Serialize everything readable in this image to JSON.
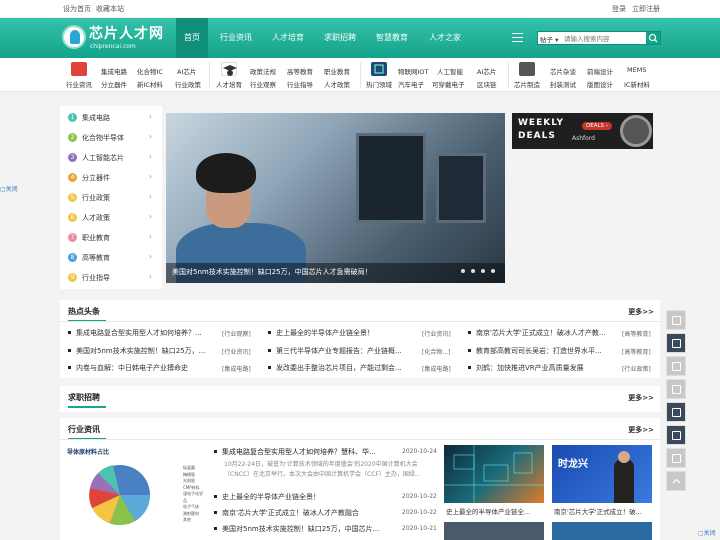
{
  "topbar": {
    "home": "设为首页",
    "favorite": "收藏本站",
    "login": "登录",
    "register": "立即注册"
  },
  "logo": {
    "name": "芯片人才网",
    "domain": "chiprencai.com"
  },
  "nav": [
    {
      "label": "首页",
      "active": true
    },
    {
      "label": "行业资讯"
    },
    {
      "label": "人才培育"
    },
    {
      "label": "求职招聘"
    },
    {
      "label": "智慧教育"
    },
    {
      "label": "人才之家"
    }
  ],
  "search": {
    "select": "帖子",
    "placeholder": "请输入搜索内容"
  },
  "categories": [
    {
      "label": "行业资讯",
      "icon": "news-icon",
      "color": "#e0433a",
      "links": [
        "集成电路",
        "化合物IC",
        "AI芯片",
        "分立器件",
        "新IC材料",
        "行业政策"
      ]
    },
    {
      "label": "人才培育",
      "icon": "graduate-icon",
      "color": "#333333",
      "links": [
        "政策法规",
        "高等教育",
        "职业教育",
        "行业观察",
        "行业指导",
        "人才政策"
      ]
    },
    {
      "label": "热门领域",
      "icon": "chip-icon",
      "color": "#1a4a7a",
      "links": [
        "物联网IOT",
        "人工智能",
        "AI芯片",
        "汽车电子",
        "可穿戴电子",
        "区块链"
      ]
    },
    {
      "label": "芯片制造",
      "icon": "wafer-icon",
      "color": "#555555",
      "links": [
        "芯片杂谈",
        "前端设计",
        "MEMS",
        "封装测试",
        "版图设计",
        "IC新材料"
      ]
    }
  ],
  "sidebar": [
    {
      "num": "1",
      "label": "集成电路",
      "color": "#4cc3b0"
    },
    {
      "num": "2",
      "label": "化合物半导体",
      "color": "#8bc34a"
    },
    {
      "num": "3",
      "label": "人工智能芯片",
      "color": "#8e6fb8"
    },
    {
      "num": "4",
      "label": "分立器件",
      "color": "#f0a23a"
    },
    {
      "num": "5",
      "label": "行业政策",
      "color": "#f4c542"
    },
    {
      "num": "6",
      "label": "人才政策",
      "color": "#f4c542"
    },
    {
      "num": "7",
      "label": "职业教育",
      "color": "#e88ca0"
    },
    {
      "num": "8",
      "label": "高等教育",
      "color": "#4a9ee0"
    },
    {
      "num": "9",
      "label": "行业指导",
      "color": "#f4c542"
    }
  ],
  "banner": {
    "caption": "美国对5nm技术实施控制！缺口25万，中国芯片人才急需破局！"
  },
  "ad": {
    "line1": "WEEKLY",
    "line2": "DEALS",
    "badge": "DEALS ›",
    "brand": "Ashford"
  },
  "close_label": "关闭",
  "hot": {
    "title": "热点头条",
    "more": "更多>>",
    "columns": [
      [
        {
          "text": "集成电路复合型实用型人才如何培养？...",
          "tag": "[行业观察]"
        },
        {
          "text": "美国对5nm技术实施控制！缺口25万，...",
          "tag": "[行业资讯]"
        },
        {
          "text": "内卷与血解：中日韩电子产业搏命史",
          "tag": "[集成电路]"
        }
      ],
      [
        {
          "text": "史上最全的半导体产业链全景！",
          "tag": "[行业资讯]"
        },
        {
          "text": "第三代半导体产业专题报告：产业链概...",
          "tag": "[化合物...]"
        },
        {
          "text": "发改委出手整治芯片项目，产能过剩会...",
          "tag": "[集成电路]"
        }
      ],
      [
        {
          "text": "南京'芯片大学'正式成立！破冰人才产教...",
          "tag": "[高等教育]"
        },
        {
          "text": "教育部高教司司长吴岩：打造世界水平...",
          "tag": "[高等教育]"
        },
        {
          "text": "刘鹤：加快推进VR产业高质量发展",
          "tag": "[行业政策]"
        }
      ]
    ]
  },
  "jobs": {
    "title": "求职招聘",
    "more": "更多>>"
  },
  "industry": {
    "title": "行业资讯",
    "more": "更多>>",
    "pie_title": "导体原材料占比",
    "pie_legend": [
      "硅晶圆",
      "掩模版",
      "光刻胶",
      "CMP材料",
      "湿电子化学品",
      "电子气体",
      "溅射靶材",
      "其他"
    ],
    "articles": [
      {
        "title": "集成电路复合型实用型人才如何培养？慧科、华...",
        "date": "2020-10-24",
        "summary": "10月22-24日，被誉为'计算技术领域的年度盛会'的2020中国计算机大会（CNCC）在北京举行。本次大会由中国计算机学会（CCF）主办，国绿..."
      },
      {
        "title": "史上最全的半导体产业链全景！",
        "date": "2020-10-22"
      },
      {
        "title": "南京'芯片大学'正式成立！破冰人才产教融合",
        "date": "2020-10-22"
      },
      {
        "title": "美国对5nm技术实施控制！缺口25万，中国芯片...",
        "date": "2020-10-21"
      }
    ],
    "thumbs": [
      {
        "caption": "史上最全的半导体产业链全..."
      },
      {
        "caption": "南京'芯片大学'正式成立！破..."
      }
    ],
    "thumb_overlay": "时龙兴"
  }
}
